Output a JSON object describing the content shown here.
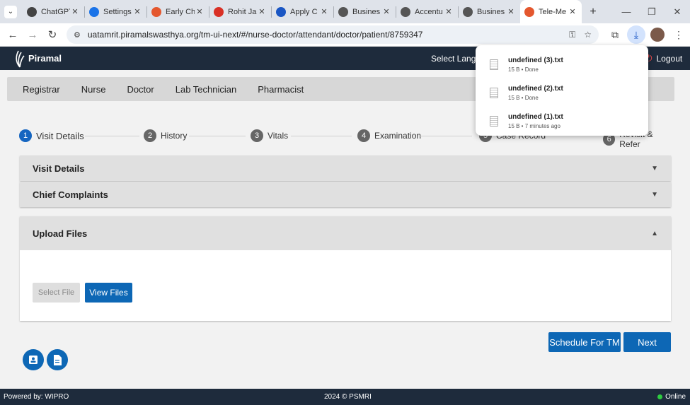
{
  "browser": {
    "tabs": [
      {
        "title": "ChatGPT",
        "favicon": "chatgpt-icon",
        "color": "#444"
      },
      {
        "title": "Settings",
        "favicon": "gear-icon",
        "color": "#1a73e8"
      },
      {
        "title": "Early Ch",
        "favicon": "piramal-icon",
        "color": "#e4572e"
      },
      {
        "title": "Rohit Ja",
        "favicon": "gmail-icon",
        "color": "#d93025"
      },
      {
        "title": "Apply C",
        "favicon": "apply-icon",
        "color": "#1a56c4"
      },
      {
        "title": "Busines",
        "favicon": "globe-icon",
        "color": "#555"
      },
      {
        "title": "Accentu",
        "favicon": "globe-icon",
        "color": "#555"
      },
      {
        "title": "Busines",
        "favicon": "globe-icon",
        "color": "#555"
      },
      {
        "title": "Tele-Me",
        "favicon": "piramal-icon",
        "color": "#e4572e",
        "active": true
      }
    ],
    "url": "uatamrit.piramalswasthya.org/tm-ui-next/#/nurse-doctor/attendant/doctor/patient/8759347"
  },
  "app": {
    "brand": "Piramal",
    "language_label": "Select Langua",
    "logout_label": "Logout"
  },
  "roles": [
    "Registrar",
    "Nurse",
    "Doctor",
    "Lab Technician",
    "Pharmacist"
  ],
  "stepper": [
    {
      "num": "1",
      "label": "Visit Details",
      "active": true
    },
    {
      "num": "2",
      "label": "History"
    },
    {
      "num": "3",
      "label": "Vitals"
    },
    {
      "num": "4",
      "label": "Examination"
    },
    {
      "num": "5",
      "label": "Case Record"
    },
    {
      "num": "6",
      "label": "Revisit & Refer"
    }
  ],
  "panels": {
    "visit_details": "Visit Details",
    "chief_complaints": "Chief Complaints",
    "upload_files": "Upload Files",
    "select_file": "Select File",
    "view_files": "View Files"
  },
  "actions": {
    "schedule": "Schedule For TM",
    "next": "Next"
  },
  "footer": {
    "powered_by": "Powered by: WIPRO",
    "copyright": "2024 © PSMRI",
    "status": "Online"
  },
  "downloads": [
    {
      "name": "undefined (3).txt",
      "meta": "15 B • Done"
    },
    {
      "name": "undefined (2).txt",
      "meta": "15 B • Done"
    },
    {
      "name": "undefined (1).txt",
      "meta": "15 B • 7 minutes ago"
    }
  ],
  "colors": {
    "header": "#1e2b3c",
    "primary": "#0d67b5",
    "active_step": "#1565c0"
  }
}
